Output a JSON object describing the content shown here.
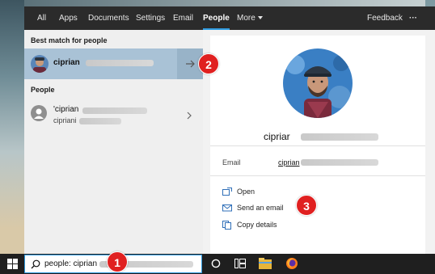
{
  "tabs": [
    {
      "label": "All"
    },
    {
      "label": "Apps"
    },
    {
      "label": "Documents"
    },
    {
      "label": "Settings"
    },
    {
      "label": "Email"
    },
    {
      "label": "People",
      "active": true
    },
    {
      "label": "More"
    }
  ],
  "topbar": {
    "feedback_label": "Feedback",
    "more_options_label": "···"
  },
  "left": {
    "best_match_title": "Best match for people",
    "best_match_name": "ciprian",
    "people_title": "People",
    "person_name": "'ciprian",
    "person_sub": "cipriani"
  },
  "right": {
    "name": "cipriar",
    "email_label": "Email",
    "email_value": "ciprian",
    "actions": [
      "Open",
      "Send an email",
      "Copy details"
    ]
  },
  "search": {
    "query": "people: ciprian"
  },
  "callouts": [
    "1",
    "2",
    "3"
  ],
  "colors": {
    "accent": "#2f9be0",
    "selected": "#a9c2d6",
    "callout": "#e02020",
    "topbar": "#2b2b2b"
  },
  "icons": [
    "windows-icon",
    "search-icon",
    "cortana-icon",
    "task-view-icon",
    "file-explorer-icon",
    "firefox-icon",
    "arrow-right-icon",
    "chevron-right-icon",
    "person-icon",
    "open-icon",
    "mail-icon",
    "copy-icon"
  ]
}
